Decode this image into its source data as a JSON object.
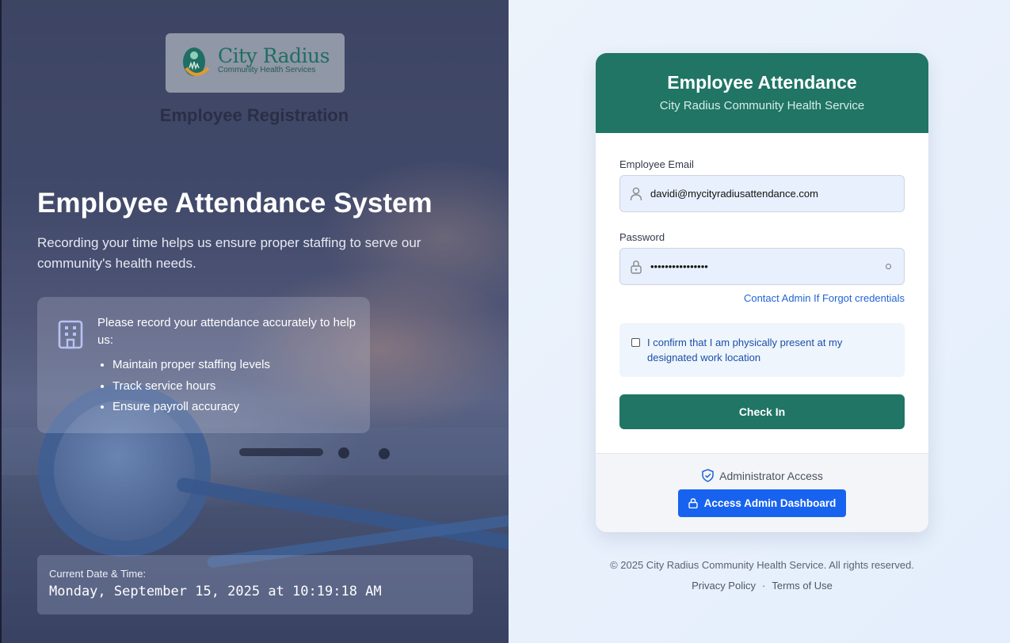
{
  "left": {
    "logo": {
      "name": "City Radius",
      "subtitle": "Community Health Services"
    },
    "registration_title": "Employee Registration",
    "hero": {
      "title": "Employee Attendance System",
      "subtitle": "Recording your time helps us ensure proper staffing to serve our community's health needs."
    },
    "info": {
      "text": "Please record your attendance accurately to help us:",
      "items": [
        "Maintain proper staffing levels",
        "Track service hours",
        "Ensure payroll accuracy"
      ]
    },
    "datetime": {
      "label": "Current Date & Time:",
      "value": "Monday, September 15, 2025 at 10:19:18 AM"
    }
  },
  "card": {
    "title": "Employee Attendance",
    "subtitle": "City Radius Community Health Service",
    "email": {
      "label": "Employee Email",
      "value": "davidi@mycityradiusattendance.com"
    },
    "password": {
      "label": "Password",
      "value": "••••••••••••••••"
    },
    "forgot_link": "Contact Admin If Forgot credentials",
    "confirm_text": "I confirm that I am physically present at my designated work location",
    "checkin_label": "Check In",
    "admin": {
      "label": "Administrator Access",
      "button_label": "Access Admin Dashboard"
    }
  },
  "footer": {
    "copyright": "© 2025 City Radius Community Health Service. All rights reserved.",
    "privacy": "Privacy Policy",
    "separator": "·",
    "terms": "Terms of Use"
  },
  "colors": {
    "brand_green": "#207565",
    "admin_blue": "#1862f0",
    "link_blue": "#1f64d6"
  },
  "icons": [
    "building-icon",
    "user-icon",
    "lock-icon",
    "eye-icon",
    "shield-check-icon",
    "lock-icon"
  ]
}
